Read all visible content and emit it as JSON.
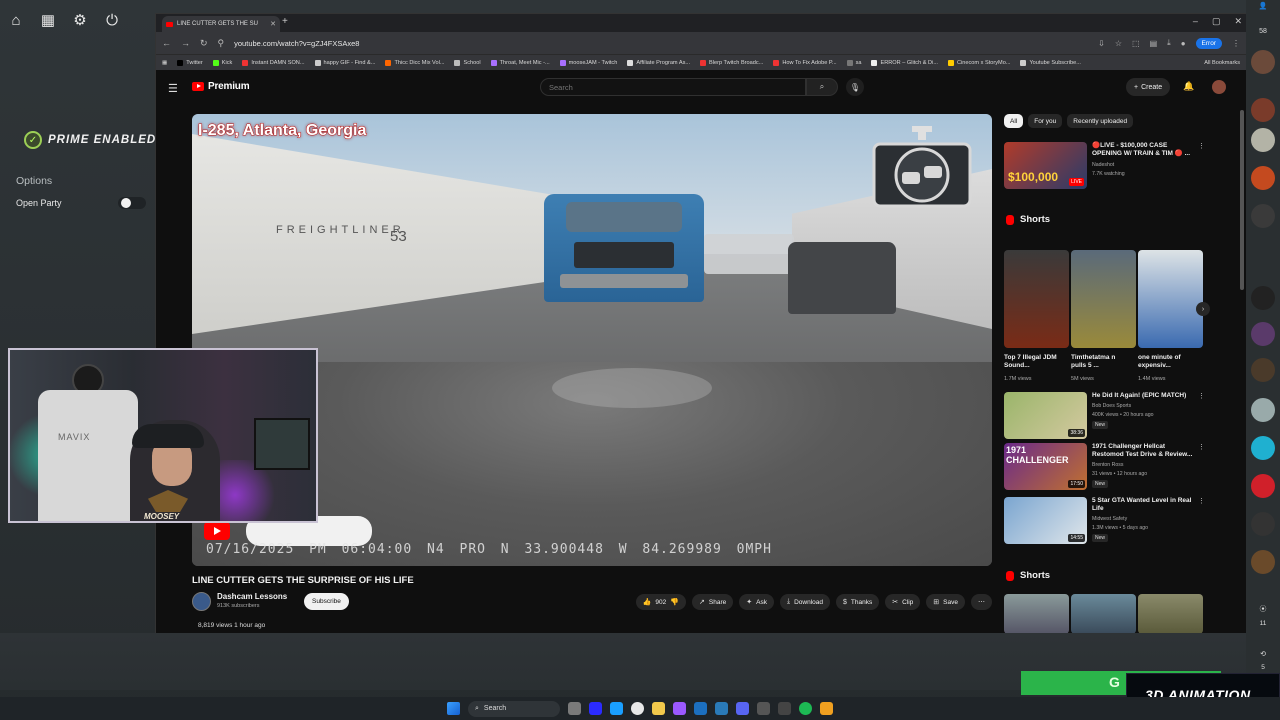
{
  "overlay": {
    "brand": "PRIME ENABLED",
    "options_label": "Options",
    "open_party_label": "Open Party"
  },
  "browser": {
    "tab_title": "LINE CUTTER GETS THE SU",
    "url": "youtube.com/watch?v=gZJ4FXSAxe8",
    "profile_status": "Error",
    "bookmarks": [
      "Twitter",
      "Kick",
      "Instant DAMN SON...",
      "happy GIF - Find &...",
      "Thicc Dicc Mix Vol...",
      "School",
      "Throat, Meet Mic -...",
      "mooseJAM - Twitch",
      "Affiliate Program As...",
      "Blerp Twitch Broadc...",
      "How To Fix Adobe P...",
      "sa",
      "ERROR – Glitch & Di...",
      "Cinecom x StoryMo...",
      "Youtube Subscribe..."
    ],
    "all_bookmarks": "All Bookmarks"
  },
  "youtube": {
    "logo_text": "Premium",
    "search_placeholder": "Search",
    "create_label": "Create",
    "video": {
      "location_overlay": "I-285, Atlanta, Georgia",
      "osd": "07/16/2025  PM 06:04:00  N4 PRO  N 33.900448  W 84.269989  0MPH",
      "truck_text": "FREIGHTLINER",
      "truck_number": "53",
      "title": "LINE CUTTER GETS THE SURPRISE OF HIS LIFE",
      "channel": "Dashcam Lessons",
      "subscribers": "913K subscribers",
      "subscribe_label": "Subscribe",
      "likes": "902",
      "share": "Share",
      "ask": "Ask",
      "download": "Download",
      "thanks": "Thanks",
      "clip": "Clip",
      "save": "Save",
      "views_line": "8,819 views  1 hour ago"
    },
    "chips": [
      "All",
      "For you",
      "Recently uploaded"
    ],
    "live_rec": {
      "title": "🔴LIVE - $100,000 CASE OPENING W/ TRAIN & TIM 🔴 ...",
      "channel": "Nadeshot",
      "meta": "7.7K watching",
      "thumb_text": "$100,000",
      "live_badge": "LIVE"
    },
    "shorts_heading": "Shorts",
    "shorts": [
      {
        "title": "Top 7 Illegal JDM Sound...",
        "views": "1.7M views"
      },
      {
        "title": "Timthetatma n pulls 5 ...",
        "views": "5M views"
      },
      {
        "title": "one minute of expensiv...",
        "views": "1.4M views"
      }
    ],
    "recs": [
      {
        "title": "He Did It Again! (EPIC MATCH)",
        "channel": "Bob Does Sports",
        "meta": "400K views • 20 hours ago",
        "duration": "38:36",
        "badge": "New"
      },
      {
        "title": "1971 Challenger Hellcat Restomod Test Drive & Review...",
        "channel": "Brenton Ross",
        "meta": "31 views • 12 hours ago",
        "duration": "17:50",
        "badge": "New",
        "thumb_text": "1971 CHALLENGER"
      },
      {
        "title": "5 Star GTA Wanted Level in Real Life",
        "channel": "Midwest Safety",
        "meta": "1.3M views • 5 days ago",
        "duration": "14:55",
        "badge": "New"
      }
    ],
    "shorts_heading_2": "Shorts"
  },
  "webcam": {
    "chair_text": "MAVIX",
    "name_tag": "MOOSEY"
  },
  "rail": {
    "top_count": "58",
    "mid_count": "11",
    "bottom_count": "5"
  },
  "banner": {
    "text": "3D ANIMATION",
    "green_text": "G"
  },
  "taskbar": {
    "search_label": "Search"
  }
}
